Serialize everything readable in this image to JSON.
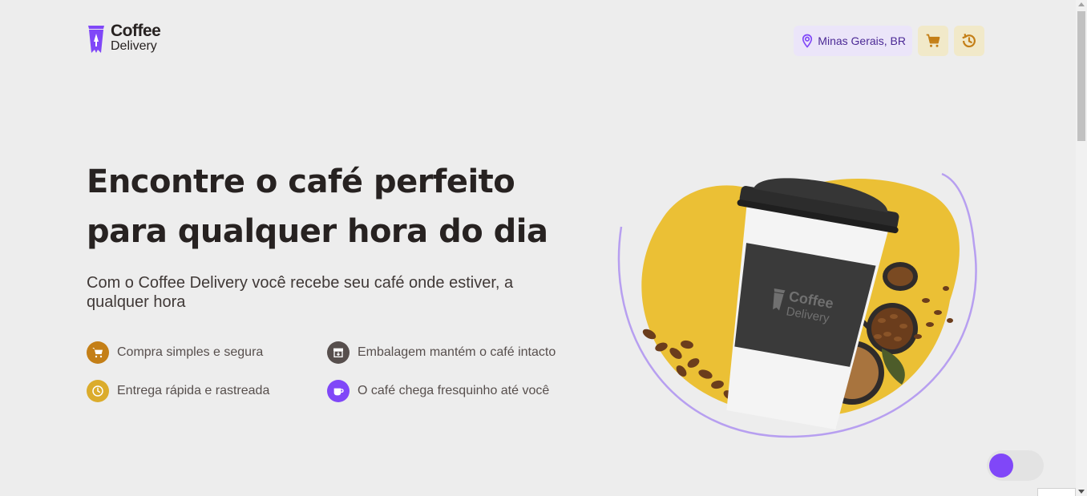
{
  "brand": {
    "name_line1": "Coffee",
    "name_line2": "Delivery"
  },
  "header": {
    "location": "Minas Gerais, BR",
    "cart_icon": "cart-icon",
    "history_icon": "history-icon"
  },
  "hero": {
    "title_line1": "Encontre o café perfeito",
    "title_line2": "para qualquer hora do dia",
    "subtitle": "Com o Coffee Delivery você recebe seu café onde estiver, a qualquer hora",
    "features": [
      {
        "label": "Compra simples e segura",
        "icon": "cart-icon",
        "color": "#c47f17"
      },
      {
        "label": "Embalagem mantém o café intacto",
        "icon": "package-icon",
        "color": "#574f4d"
      },
      {
        "label": "Entrega rápida e rastreada",
        "icon": "clock-icon",
        "color": "#dbac2c"
      },
      {
        "label": "O café chega fresquinho até você",
        "icon": "coffee-icon",
        "color": "#8047f8"
      }
    ],
    "image_cup_brand_line1": "Coffee",
    "image_cup_brand_line2": "Delivery"
  },
  "colors": {
    "background": "#ededed",
    "purple": "#8047f8",
    "purple_light": "#ebe5f9",
    "yellow_dark": "#c47f17",
    "yellow": "#dbac2c",
    "yellow_light": "#f1e9c9"
  },
  "theme_toggle": {
    "state": "off"
  }
}
